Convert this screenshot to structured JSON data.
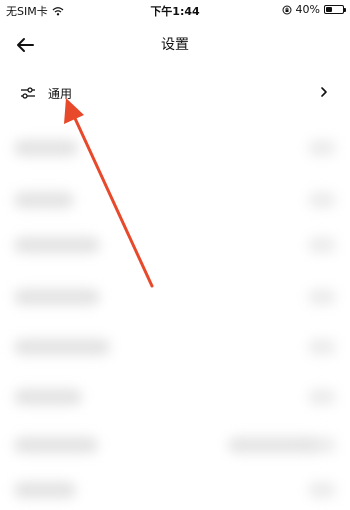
{
  "status_bar": {
    "carrier": "无SIM卡",
    "time": "下午1:44",
    "battery": "40%",
    "battery_level": 0.4
  },
  "header": {
    "title": "设置"
  },
  "settings": {
    "general_label": "通用"
  },
  "annotation": {
    "arrow_color": "#e8492b"
  }
}
